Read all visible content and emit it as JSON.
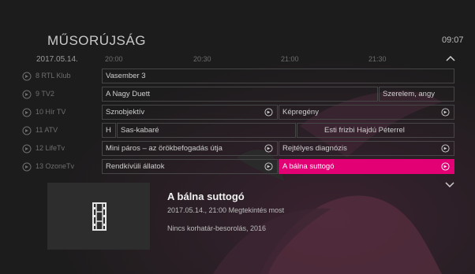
{
  "header": {
    "title": "MŰSORÚJSÁG",
    "clock": "09:07"
  },
  "timeline": {
    "date": "2017.05.14.",
    "times": [
      "20:00",
      "20:30",
      "21:00",
      "21:30"
    ]
  },
  "channels": [
    {
      "name": "8 RTL Klub",
      "programs": [
        {
          "title": "Vasember 3"
        }
      ]
    },
    {
      "name": "9 TV2",
      "programs": [
        {
          "title": "A Nagy Duett"
        },
        {
          "title": "Szerelem, angy"
        }
      ]
    },
    {
      "name": "10 Hír TV",
      "programs": [
        {
          "title": "Sznobjektív"
        },
        {
          "title": "Képregény"
        }
      ]
    },
    {
      "name": "11 ATV",
      "programs": [
        {
          "title": "H"
        },
        {
          "title": "Sas-kabaré"
        },
        {
          "title": "Esti frizbi Hajdú Péterrel"
        }
      ]
    },
    {
      "name": "12 LifeTv",
      "programs": [
        {
          "title": "Mini páros – az örökbefogadás útja"
        },
        {
          "title": "Rejtélyes diagnózis"
        }
      ]
    },
    {
      "name": "13 OzoneTv",
      "programs": [
        {
          "title": "Rendkívüli állatok"
        },
        {
          "title": "A bálna suttogó"
        }
      ]
    }
  ],
  "details": {
    "title": "A bálna suttogó",
    "line1": "2017.05.14., 21:00 Megtekintés most",
    "line2": "Nincs korhatár-besorolás, 2016"
  },
  "colors": {
    "accent": "#e20074",
    "background": "#1c1c1c"
  },
  "icons": {
    "channel": "replay-icon",
    "record": "replay-icon",
    "thumbnail": "film-icon"
  }
}
